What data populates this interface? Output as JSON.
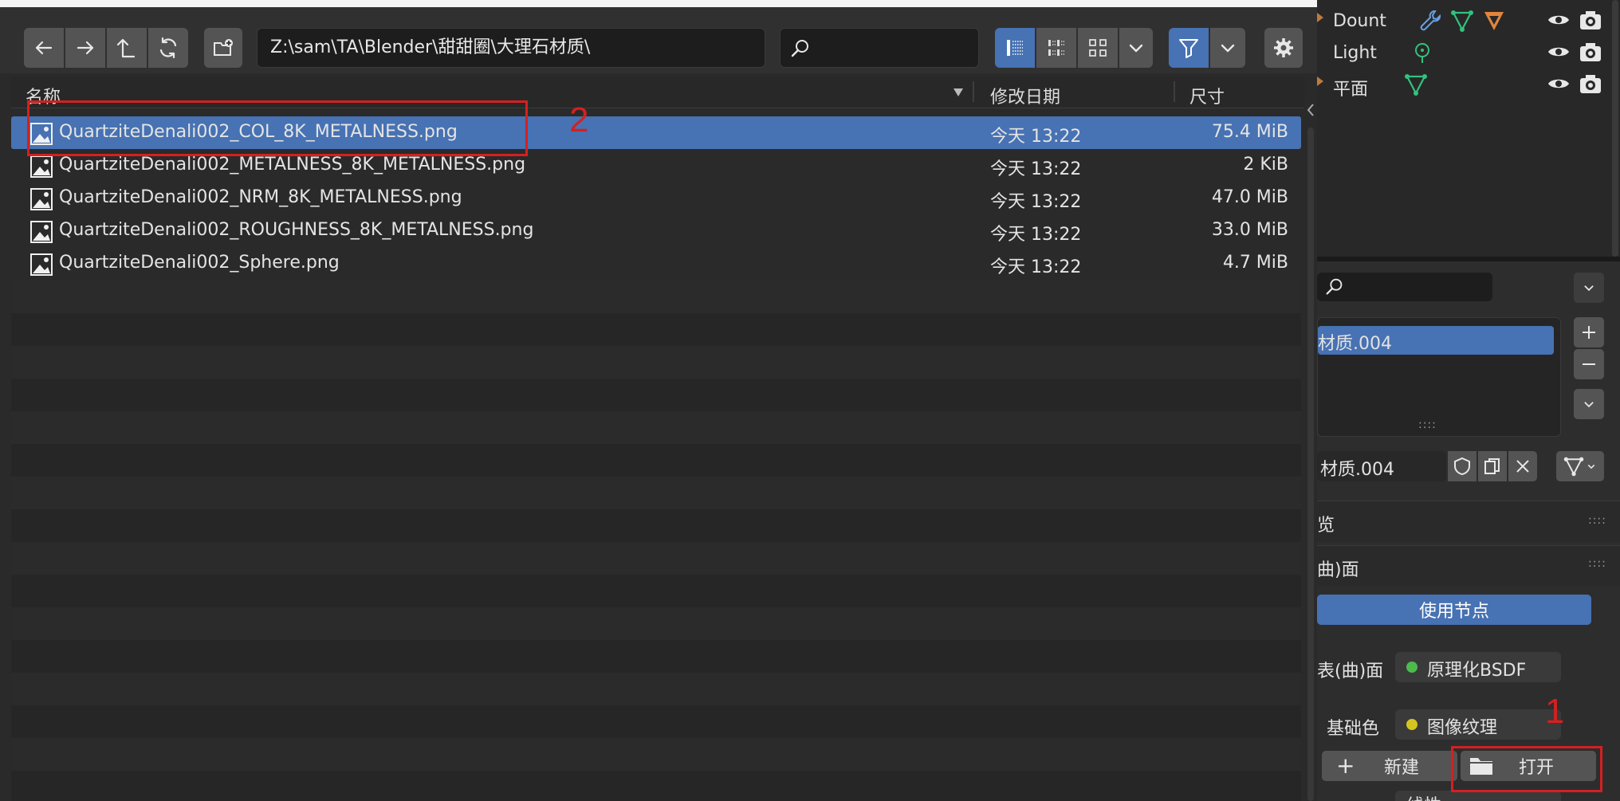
{
  "toolbar": {
    "back_icon": "arrow-left-icon",
    "forward_icon": "arrow-right-icon",
    "parent_icon": "parent-dir-icon",
    "refresh_icon": "refresh-icon",
    "new_folder_icon": "new-folder-icon",
    "path": "Z:\\sam\\TA\\Blender\\甜甜圈\\大理石材质\\",
    "search_placeholder": "",
    "view_modes": [
      "vertical-list-icon",
      "horizontal-list-icon",
      "thumbnails-icon"
    ],
    "filter_icon": "filter-icon",
    "settings_icon": "gear-icon"
  },
  "columns": {
    "name": "名称",
    "date": "修改日期",
    "size": "尺寸"
  },
  "files": [
    {
      "name": "QuartziteDenali002_COL_8K_METALNESS.png",
      "date": "今天 13:22",
      "size": "75.4 MiB",
      "selected": true
    },
    {
      "name": "QuartziteDenali002_METALNESS_8K_METALNESS.png",
      "date": "今天 13:22",
      "size": "2 KiB",
      "selected": false
    },
    {
      "name": "QuartziteDenali002_NRM_8K_METALNESS.png",
      "date": "今天 13:22",
      "size": "47.0 MiB",
      "selected": false
    },
    {
      "name": "QuartziteDenali002_ROUGHNESS_8K_METALNESS.png",
      "date": "今天 13:22",
      "size": "33.0 MiB",
      "selected": false
    },
    {
      "name": "QuartziteDenali002_Sphere.png",
      "date": "今天 13:22",
      "size": "4.7 MiB",
      "selected": false
    }
  ],
  "annotations": [
    "2",
    "1"
  ],
  "outliner": {
    "items": [
      {
        "label": "Dount"
      },
      {
        "label": "Light"
      },
      {
        "label": "平面"
      }
    ]
  },
  "properties": {
    "material_slot": "材质.004",
    "material_name": "材质.004",
    "section_preview_partial": "览",
    "section_surface_partial": "曲)面",
    "use_nodes_label": "使用节点",
    "surface_label": "表(曲)面",
    "surface_value": "原理化BSDF",
    "base_color_label": "基础色",
    "base_color_value": "图像纹理",
    "new_label": "新建",
    "open_label": "打开",
    "bottom_partial": "线性"
  },
  "colors": {
    "selection": "#4772b3",
    "annotation": "#d42020",
    "surface_dot": "#4cbb4c",
    "base_color_dot": "#d4c421"
  }
}
